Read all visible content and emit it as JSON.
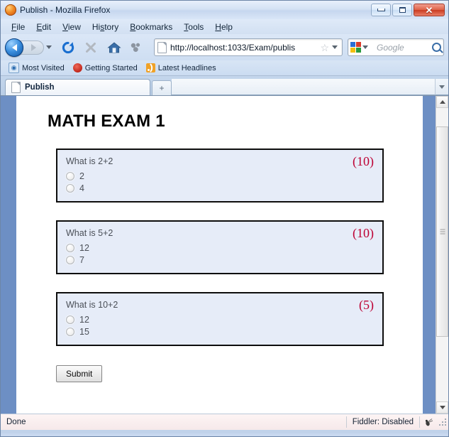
{
  "window": {
    "title": "Publish - Mozilla Firefox",
    "controls": {
      "minimize": "minimize",
      "maximize": "maximize",
      "close": "close"
    }
  },
  "menubar": {
    "items": [
      {
        "label": "File",
        "accesskey": "F",
        "rest": "ile"
      },
      {
        "label": "Edit",
        "accesskey": "E",
        "rest": "dit"
      },
      {
        "label": "View",
        "accesskey": "V",
        "rest": "iew"
      },
      {
        "label": "History",
        "accesskey": "H",
        "rest": "istory"
      },
      {
        "label": "Bookmarks",
        "accesskey": "B",
        "rest": "ookmarks"
      },
      {
        "label": "Tools",
        "accesskey": "T",
        "rest": "ools"
      },
      {
        "label": "Help",
        "accesskey": "H",
        "rest": "elp"
      }
    ]
  },
  "toolbar": {
    "back": "Back",
    "forward": "Forward",
    "reload": "Reload",
    "stop": "Stop",
    "home": "Home",
    "extension": "Extension",
    "url": {
      "value": "http://localhost:1033/Exam/publis",
      "bookmark_star": "☆"
    },
    "search": {
      "engine": "Google",
      "placeholder": "Google"
    }
  },
  "bookmarks_bar": {
    "items": [
      {
        "label": "Most Visited",
        "icon": "bookmark-globe-icon"
      },
      {
        "label": "Getting Started",
        "icon": "firefox-start-icon"
      },
      {
        "label": "Latest Headlines",
        "icon": "rss-feed-icon"
      }
    ]
  },
  "tabstrip": {
    "tabs": [
      {
        "label": "Publish",
        "active": true
      }
    ],
    "new_tab_label": "+",
    "tab_list_label": "▾"
  },
  "page": {
    "heading": "MATH EXAM 1",
    "questions": [
      {
        "text": "What is 2+2",
        "points": "(10)",
        "options": [
          "2",
          "4"
        ]
      },
      {
        "text": "What is 5+2",
        "points": "(10)",
        "options": [
          "12",
          "7"
        ]
      },
      {
        "text": "What is 10+2",
        "points": "(5)",
        "options": [
          "12",
          "15"
        ]
      }
    ],
    "submit_label": "Submit"
  },
  "statusbar": {
    "left_text": "Done",
    "right_text": "Fiddler: Disabled"
  },
  "colors": {
    "question_fill": "#e6ecf8",
    "question_border": "#0d0d0d",
    "points_red": "#bd0033",
    "page_band_blue": "#6d8fc4",
    "chrome_blue": "#d2e0f2"
  }
}
